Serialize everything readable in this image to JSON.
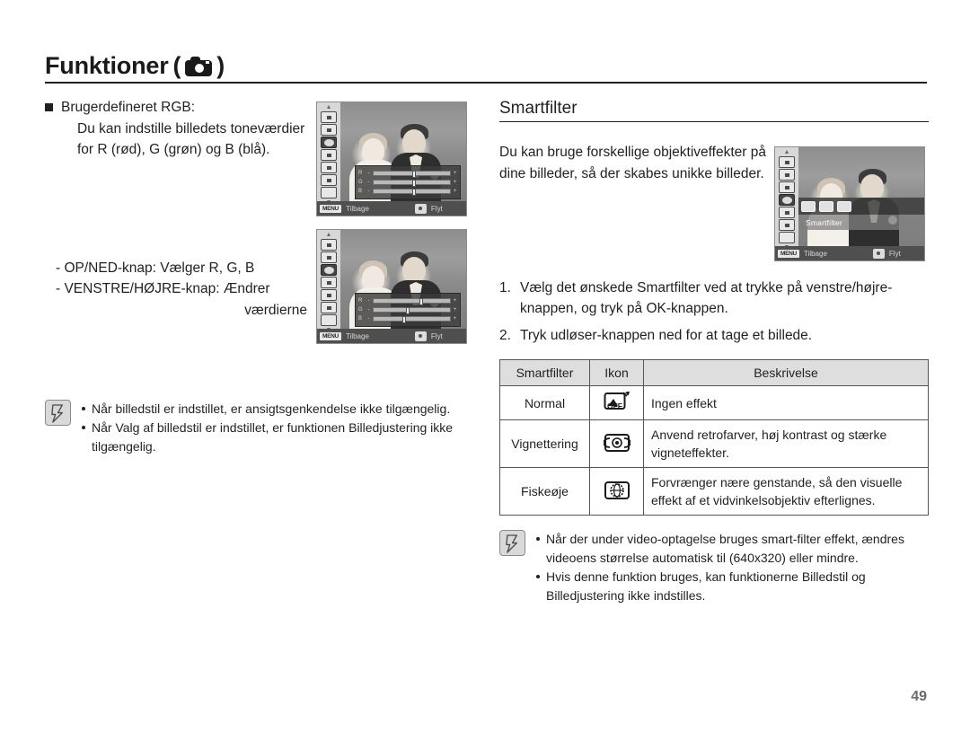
{
  "header": {
    "title": "Funktioner",
    "paren_open": "(",
    "paren_close": ")",
    "icon": "camera-icon"
  },
  "left_column": {
    "bullet_heading": "Brugerdefineret RGB:",
    "bullet_line2": "Du kan indstille billedets toneværdier",
    "bullet_line3": "for R (rød), G (grøn) og B (blå).",
    "key_line1": "- OP/NED-knap: Vælger R, G, B",
    "key_line2": "- VENSTRE/HØJRE-knap: Ændrer",
    "key_line3": "værdierne",
    "note": {
      "icon": "pen-note-icon",
      "items": [
        "Når billedstil er indstillet, er ansigtsgenkendelse ikke tilgængelig.",
        "Når Valg af billedstil er indstillet, er funktionen Billedjustering ikke tilgængelig."
      ]
    }
  },
  "lcd_screens": {
    "screen1": {
      "menu_button": "MENU",
      "back_label": "Tilbage",
      "move_label": "Flyt",
      "sliders": [
        {
          "label": "R",
          "minus": "-",
          "plus": "+",
          "pos": 52
        },
        {
          "label": "G",
          "minus": "-",
          "plus": "+",
          "pos": 52
        },
        {
          "label": "B",
          "minus": "-",
          "plus": "+",
          "pos": 52
        }
      ]
    },
    "screen2": {
      "menu_button": "MENU",
      "back_label": "Tilbage",
      "move_label": "Flyt",
      "sliders": [
        {
          "label": "R",
          "minus": "-",
          "plus": "+",
          "pos": 62
        },
        {
          "label": "G",
          "minus": "-",
          "plus": "+",
          "pos": 44
        },
        {
          "label": "B",
          "minus": "-",
          "plus": "+",
          "pos": 40
        }
      ]
    },
    "screen3": {
      "menu_button": "MENU",
      "back_label": "Tilbage",
      "move_label": "Flyt",
      "filter_label": "Smartfilter"
    }
  },
  "right_column": {
    "section_title": "Smartfilter",
    "intro_line1": "Du kan bruge forskellige objektiveffekter på",
    "intro_line2": "dine billeder, så der skabes unikke billeder.",
    "steps": [
      {
        "n": "1.",
        "line1": "Vælg det ønskede Smartfilter ved at trykke på venstre/højre-",
        "line2": "knappen, og tryk på OK-knappen."
      },
      {
        "n": "2.",
        "line1": "Tryk udløser-knappen ned for at tage et billede.",
        "line2": ""
      }
    ],
    "table": {
      "columns": [
        "Smartfilter",
        "Ikon",
        "Beskrivelse"
      ],
      "rows": [
        {
          "name": "Normal",
          "icon": "filter-off-icon",
          "desc_line1": "Ingen effekt",
          "desc_line2": ""
        },
        {
          "name": "Vignettering",
          "icon": "vignette-icon",
          "desc_line1": "Anvend retrofarver, høj kontrast og stærke",
          "desc_line2": "vigneteffekter."
        },
        {
          "name": "Fiskeøje",
          "icon": "fisheye-icon",
          "desc_line1": "Forvrænger nære genstande, så den visuelle",
          "desc_line2": "effekt af et vidvinkelsobjektiv efterlignes."
        }
      ]
    },
    "note": {
      "icon": "pen-note-icon",
      "items": [
        {
          "line1": "Når der under video-optagelse bruges smart-filter effekt, ændres",
          "line2": "videoens størrelse automatisk til (640x320) eller mindre."
        },
        {
          "line1": "Hvis denne funktion bruges, kan funktionerne Billedstil og",
          "line2": "Billedjustering ikke indstilles."
        }
      ]
    }
  },
  "footer": {
    "page_number": "49"
  },
  "colors": {
    "text": "#231f20",
    "rule": "#231f20",
    "table_header_bg": "#dedede",
    "table_border": "#555555",
    "page_number": "#6b6b6b"
  }
}
